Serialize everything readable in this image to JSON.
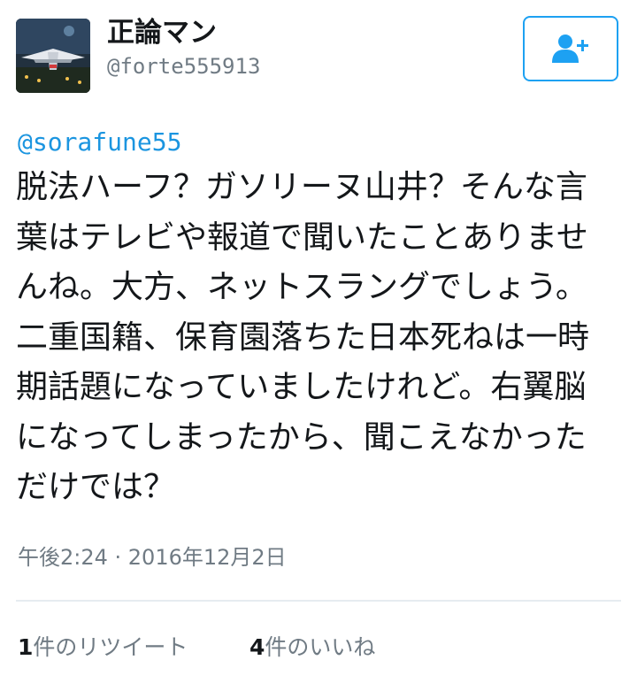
{
  "author": {
    "display_name": "正論マン",
    "handle": "@forte555913"
  },
  "follow_button": {
    "icon": "add-user-icon",
    "color": "#1da1f2"
  },
  "tweet": {
    "reply_to": "@sorafune55",
    "lines": [
      "脱法ハーフ？ガソリーヌ山井？そんな言",
      "葉はテレビや報道で聞いたことありませ",
      "んね。大方、ネットスラングでしょう。",
      "二重国籍、保育園落ちた日本死ねは一時",
      "期話題になっていましたけれど。右翼脳",
      "になってしまったから、聞こえなかった",
      "だけでは？"
    ],
    "timestamp": "午後2:24 · 2016年12月2日"
  },
  "stats": {
    "retweets": {
      "count": "1",
      "label": "件のリツイート"
    },
    "likes": {
      "count": "4",
      "label": "件のいいね"
    }
  },
  "colors": {
    "link": "#1b95e0",
    "muted": "#707b84",
    "text": "#14171a",
    "divider": "#e6ecf0"
  }
}
